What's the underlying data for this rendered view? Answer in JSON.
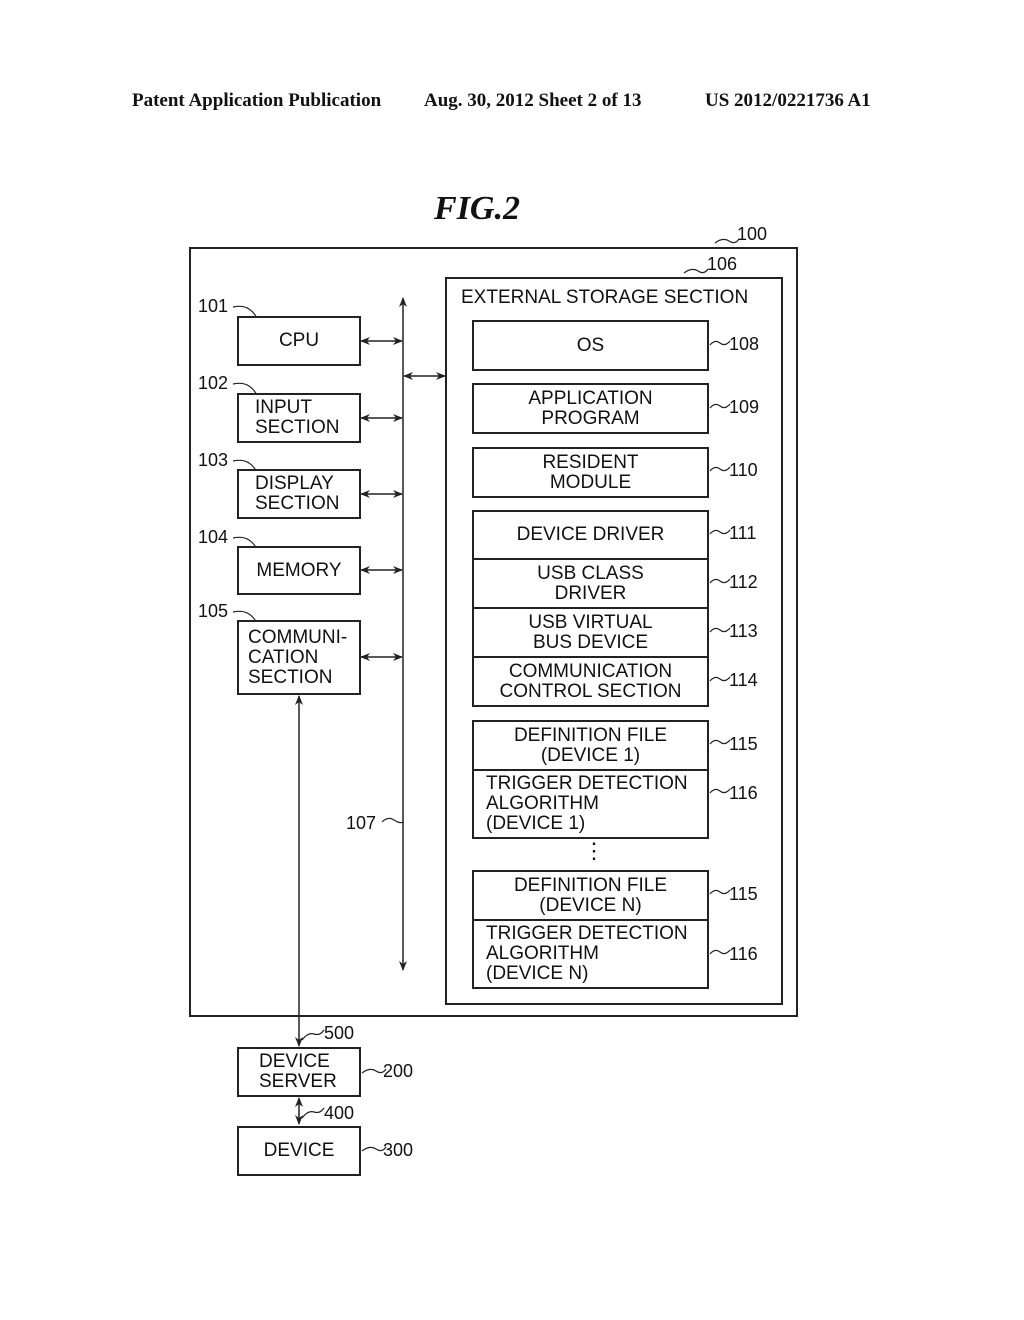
{
  "header": {
    "publication": "Patent Application Publication",
    "date_sheet": "Aug. 30, 2012   Sheet 2 of 13",
    "patent_number": "US 2012/0221736 A1"
  },
  "figure": {
    "title": "FIG.2",
    "system_ref": "100",
    "bus_ref": "107",
    "storage": {
      "ref": "106",
      "title": "EXTERNAL STORAGE SECTION",
      "ellipsis": "⋮",
      "items": [
        {
          "label": "OS",
          "ref": "108"
        },
        {
          "label": "APPLICATION\nPROGRAM",
          "ref": "109"
        },
        {
          "label": "RESIDENT\nMODULE",
          "ref": "110"
        },
        {
          "label": "DEVICE DRIVER",
          "ref": "111"
        },
        {
          "label": "USB CLASS\nDRIVER",
          "ref": "112"
        },
        {
          "label": "USB VIRTUAL\nBUS DEVICE",
          "ref": "113"
        },
        {
          "label": "COMMUNICATION\nCONTROL SECTION",
          "ref": "114"
        },
        {
          "label": "DEFINITION FILE\n(DEVICE 1)",
          "ref": "115"
        },
        {
          "label": "TRIGGER DETECTION\nALGORITHM\n(DEVICE 1)",
          "ref": "116"
        },
        {
          "label": "DEFINITION FILE\n(DEVICE N)",
          "ref": "115"
        },
        {
          "label": "TRIGGER DETECTION\nALGORITHM\n(DEVICE N)",
          "ref": "116"
        }
      ]
    },
    "components": [
      {
        "label": "CPU",
        "ref": "101"
      },
      {
        "label": "INPUT\nSECTION",
        "ref": "102"
      },
      {
        "label": "DISPLAY\nSECTION",
        "ref": "103"
      },
      {
        "label": "MEMORY",
        "ref": "104"
      },
      {
        "label": "COMMUNI-\nCATION\nSECTION",
        "ref": "105"
      }
    ],
    "external": {
      "network_ref": "500",
      "device_server": {
        "label": "DEVICE\nSERVER",
        "ref": "200"
      },
      "link_ref": "400",
      "device": {
        "label": "DEVICE",
        "ref": "300"
      }
    }
  }
}
